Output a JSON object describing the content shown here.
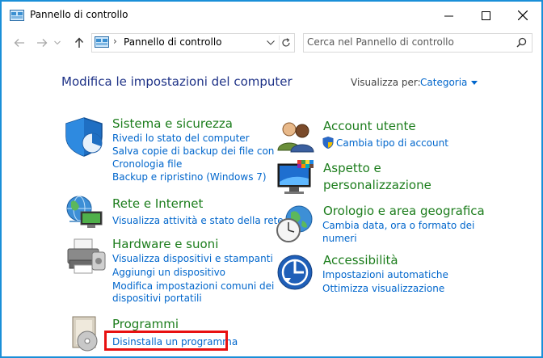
{
  "window": {
    "title": "Pannello di controllo"
  },
  "address_bar": {
    "path": "Pannello di controllo",
    "separator": "›"
  },
  "search": {
    "placeholder": "Cerca nel Pannello di controllo"
  },
  "header": {
    "title": "Modifica le impostazioni del computer",
    "view_by_label": "Visualizza per:",
    "view_by_value": "Categoria"
  },
  "categories": {
    "system": {
      "title": "Sistema e sicurezza",
      "links": [
        "Rivedi lo stato del computer",
        "Salva copie di backup dei file con",
        "Cronologia file",
        "Backup e ripristino (Windows 7)"
      ]
    },
    "network": {
      "title": "Rete e Internet",
      "links": [
        "Visualizza attività e stato della rete"
      ]
    },
    "hardware": {
      "title": "Hardware e suoni",
      "links": [
        "Visualizza dispositivi e stampanti",
        "Aggiungi un dispositivo",
        "Modifica impostazioni comuni dei",
        "dispositivi portatili"
      ]
    },
    "programs": {
      "title": "Programmi",
      "links": [
        "Disinstalla un programma"
      ]
    },
    "accounts": {
      "title": "Account utente",
      "links": [
        "Cambia tipo di account"
      ]
    },
    "appearance": {
      "title": "Aspetto e",
      "title2": "personalizzazione",
      "links": []
    },
    "clock": {
      "title": "Orologio e area geografica",
      "links": [
        "Cambia data, ora o formato dei",
        "numeri"
      ]
    },
    "access": {
      "title": "Accessibilità",
      "links": [
        "Impostazioni automatiche",
        "Ottimizza visualizzazione"
      ]
    }
  },
  "colors": {
    "accent_border": "#1a8fd8",
    "heading_blue": "#1e3287",
    "category_green": "#1c7d1c",
    "link_blue": "#0066cc",
    "highlight_red": "#e81010"
  }
}
